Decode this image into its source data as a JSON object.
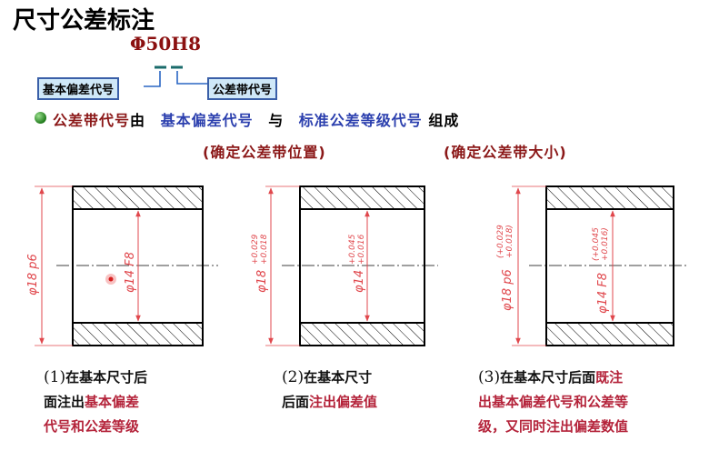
{
  "title": "尺寸公差标注",
  "code": "Φ50H8",
  "labels": {
    "basic_deviation_code": "基本偏差代号",
    "tolerance_zone_code": "公差带代号"
  },
  "statement": {
    "part1": "公差带代号",
    "part2": "由",
    "part3": "基本偏差代号",
    "part4": "与",
    "part5": "标准公差等级代号",
    "part6": "组成"
  },
  "notes": {
    "left": "(确定公差带位置)",
    "right": "(确定公差带大小)"
  },
  "drawings": [
    {
      "outer_dim": "φ18 p6",
      "inner_dim": "φ14 F8"
    },
    {
      "outer_dim_base": "φ18",
      "outer_dim_upper": "+0.029",
      "outer_dim_lower": "+0.018",
      "inner_dim_base": "φ14",
      "inner_dim_upper": "+0.045",
      "inner_dim_lower": "+0.016"
    },
    {
      "outer_dim_base": "φ18 p6",
      "outer_dim_upper": "(+0.029",
      "outer_dim_lower": "+0.018)",
      "inner_dim_base": "φ14 F8",
      "inner_dim_upper": "(+0.045",
      "inner_dim_lower": "+0.016)"
    }
  ],
  "captions": [
    {
      "num": "(1)",
      "l1a": "在基本尺寸后",
      "l2a": "面注出",
      "l2b": "基本偏差",
      "l3a": "代号和公差等级"
    },
    {
      "num": "(2)",
      "l1a": "在基本尺寸",
      "l2a": "后面",
      "l2b": "注出偏差值"
    },
    {
      "num": "(3)",
      "l1a": "在基本尺寸后面",
      "l1b": "既注",
      "l2a": "出基本偏差代号和公差等",
      "l3a": "级，又同时注出偏差数值"
    }
  ],
  "colors": {
    "dimension": "#e0474c",
    "caption_highlight": "#b4233a",
    "blue_text": "#2b3fae",
    "maroon_text": "#8b1818"
  }
}
